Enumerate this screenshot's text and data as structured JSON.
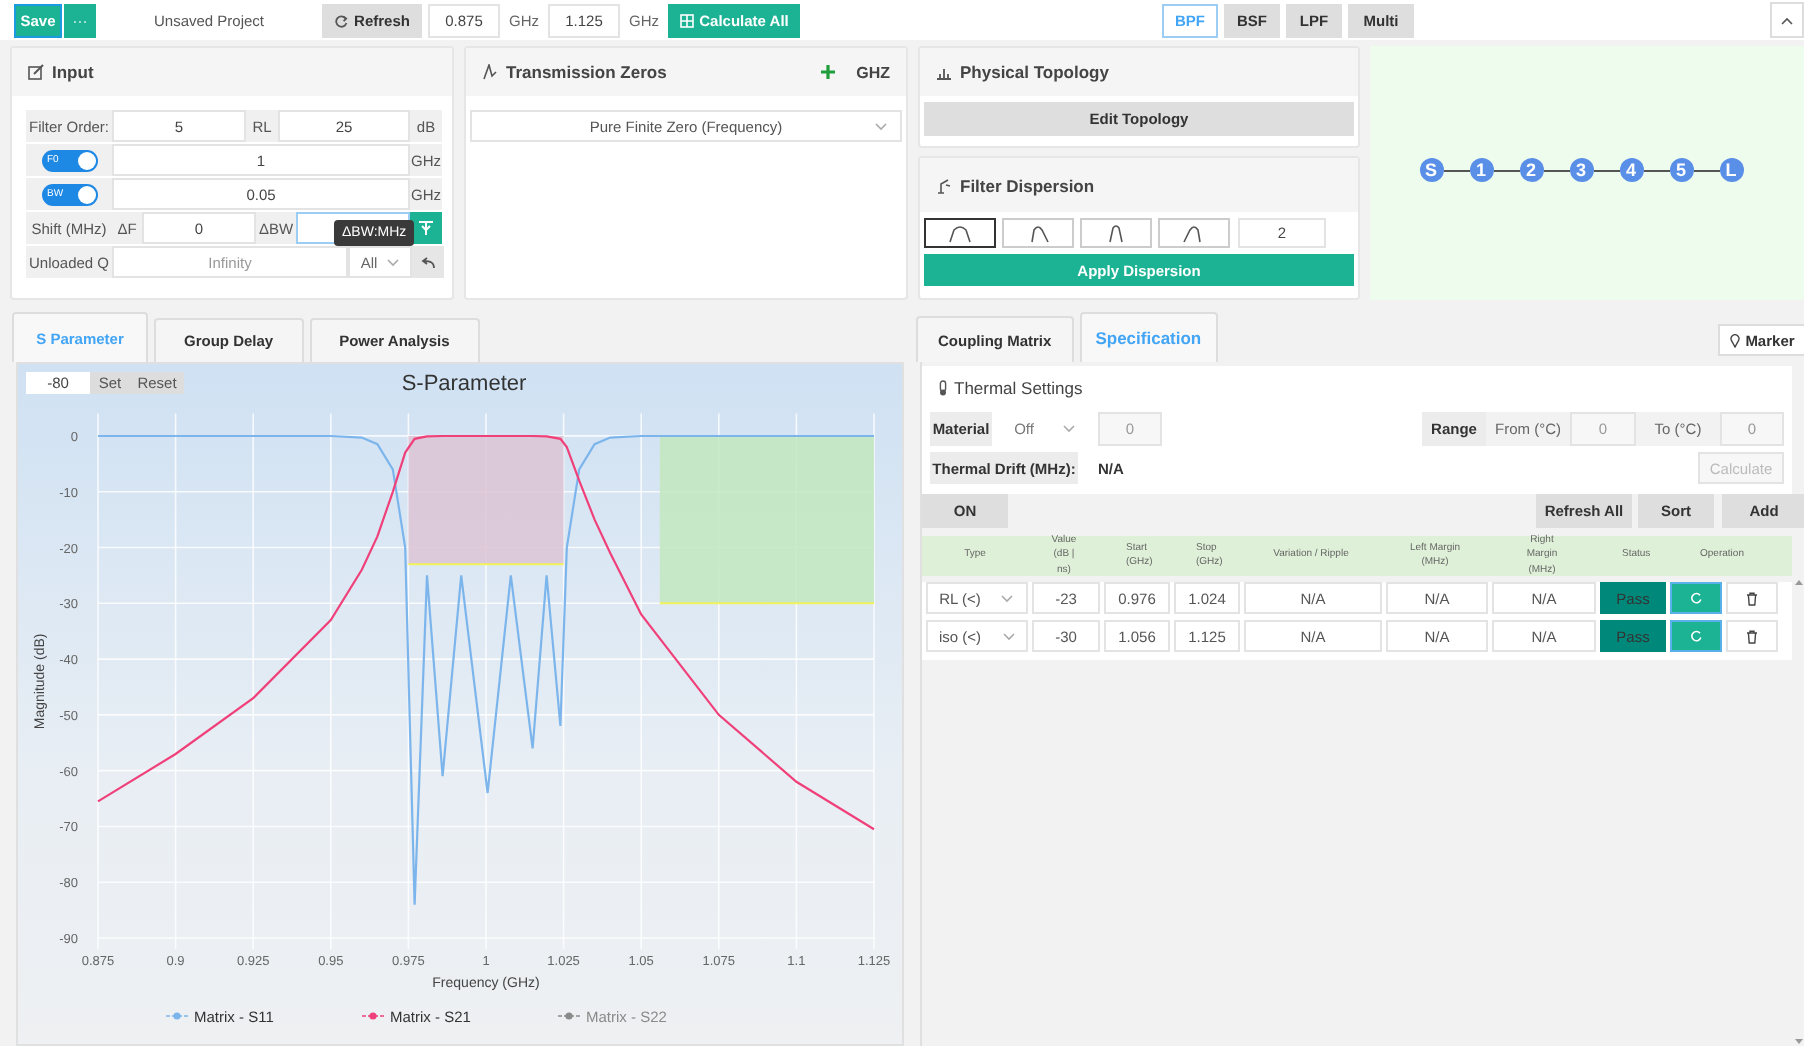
{
  "toolbar": {
    "save": "Save",
    "more": "···",
    "project_name": "Unsaved Project",
    "refresh": "Refresh",
    "freq_start": "0.875",
    "freq_start_unit": "GHz",
    "freq_stop": "1.125",
    "freq_stop_unit": "GHz",
    "calculate": "Calculate All",
    "filter_types": [
      {
        "label": "BPF",
        "selected": true
      },
      {
        "label": "BSF",
        "selected": false
      },
      {
        "label": "LPF",
        "selected": false
      },
      {
        "label": "Multi",
        "selected": false
      }
    ]
  },
  "input": {
    "title": "Input",
    "filter_order_label": "Filter Order:",
    "filter_order": "5",
    "rl_label": "RL",
    "rl": "25",
    "rl_unit": "dB",
    "f0_toggle": {
      "label": "F0",
      "on": true
    },
    "f0": "1",
    "f0_unit": "GHz",
    "bw_toggle": {
      "label": "BW",
      "on": true
    },
    "bw": "0.05",
    "bw_unit": "GHz",
    "shift_label": "Shift (MHz)",
    "delta_f_label": "ΔF",
    "delta_f": "0",
    "delta_bw_label": "ΔBW",
    "tooltip": "ΔBW:MHz",
    "q_label": "Unloaded Q",
    "q_value": "Infinity",
    "q_scope": "All"
  },
  "transmission_zeros": {
    "title": "Transmission Zeros",
    "unit": "GHZ",
    "type": "Pure Finite Zero (Frequency)"
  },
  "physical_topology": {
    "title": "Physical Topology",
    "edit": "Edit Topology"
  },
  "filter_dispersion": {
    "title": "Filter Dispersion",
    "value": "2",
    "apply": "Apply Dispersion",
    "shapes": [
      {
        "kind": "wide",
        "selected": true
      },
      {
        "kind": "right-skew",
        "selected": false
      },
      {
        "kind": "narrow",
        "selected": false
      },
      {
        "kind": "left-skew",
        "selected": false
      }
    ]
  },
  "topology": {
    "nodes": [
      "S",
      "1",
      "2",
      "3",
      "4",
      "5",
      "L"
    ]
  },
  "chart_tabs": [
    {
      "label": "S Parameter",
      "selected": true
    },
    {
      "label": "Group Delay",
      "selected": false
    },
    {
      "label": "Power Analysis",
      "selected": false
    }
  ],
  "chart": {
    "limit_value": "-80",
    "set": "Set",
    "reset": "Reset",
    "legend": [
      {
        "visible": true
      },
      {
        "visible": true
      },
      {
        "visible": false
      }
    ],
    "chart_data": {
      "type": "line",
      "grid": true,
      "title": "S-Parameter",
      "xlabel": "Frequency (GHz)",
      "ylabel": "Magnitude (dB)",
      "xlim": [
        0.875,
        1.125
      ],
      "ylim": [
        -92,
        4
      ],
      "xticks": [
        0.875,
        0.9,
        0.925,
        0.95,
        0.975,
        1,
        1.025,
        1.05,
        1.075,
        1.1,
        1.125
      ],
      "yticks": [
        0,
        -10,
        -20,
        -30,
        -40,
        -50,
        -60,
        -70,
        -80,
        -90
      ],
      "x": [
        0.875,
        0.9,
        0.925,
        0.95,
        0.96,
        0.965,
        0.97,
        0.974,
        0.977,
        0.981,
        0.986,
        0.992,
        1.0005,
        1.008,
        1.015,
        1.0195,
        1.024,
        1.026,
        1.03,
        1.035,
        1.04,
        1.05,
        1.075,
        1.1,
        1.125
      ],
      "series": [
        {
          "name": "Matrix - S11",
          "color": "#7cb5ec",
          "values": [
            0,
            0,
            0,
            0,
            -0.3,
            -1.5,
            -6,
            -20,
            -84,
            -25,
            -61,
            -25,
            -64,
            -25,
            -56,
            -25,
            -52,
            -20,
            -6,
            -1.5,
            -0.3,
            0,
            0,
            0,
            0
          ]
        },
        {
          "name": "Matrix - S21",
          "color": "#f0407a",
          "values": [
            -65.5,
            -57,
            -47,
            -33,
            -24,
            -18,
            -10,
            -3,
            -0.5,
            -0.1,
            0,
            0,
            0,
            0,
            0,
            -0.1,
            -0.5,
            -2,
            -8,
            -15,
            -21,
            -32,
            -50,
            -62,
            -70.5
          ]
        },
        {
          "name": "Matrix - S22",
          "color": "#8a8a8a",
          "values": [
            null,
            null,
            null,
            null,
            null,
            null,
            null,
            null,
            null,
            null,
            null,
            null,
            null,
            null,
            null,
            null,
            null,
            null,
            null,
            null,
            null,
            null,
            null,
            null,
            null
          ]
        }
      ],
      "bands": [
        {
          "axis": "x",
          "from": 0.975,
          "to": 1.025,
          "color": "#dcc3d3"
        },
        {
          "axis": "x",
          "from": 1.056,
          "to": 1.125,
          "color": "#c2e8bd"
        }
      ],
      "ref_lines": [
        {
          "axis": "y",
          "value": -23,
          "color": "#f2f25a"
        },
        {
          "axis": "y",
          "value": -30,
          "color": "#f2f25a"
        }
      ]
    }
  },
  "spec_tabs": [
    {
      "label": "Coupling Matrix",
      "selected": false
    },
    {
      "label": "Specification",
      "selected": true
    }
  ],
  "marker": "Marker",
  "thermal": {
    "title": "Thermal Settings",
    "material_label": "Material",
    "material": "Off",
    "material_value": "0",
    "range_label": "Range",
    "from_label": "From (°C)",
    "from": "0",
    "to_label": "To (°C)",
    "to": "0",
    "drift_label": "Thermal Drift (MHz):",
    "drift": "N/A",
    "calculate": "Calculate",
    "calculate_disabled": true
  },
  "spec_toolbar": {
    "on": "ON",
    "refresh_all": "Refresh All",
    "sort": "Sort",
    "add": "Add"
  },
  "spec_table": {
    "columns": [
      "Type",
      "Value (dB | ns)",
      "Start (GHz)",
      "Stop (GHz)",
      "Variation / Ripple",
      "Left Margin (MHz)",
      "Right Margin (MHz)",
      "Status",
      "Operation"
    ],
    "rows": [
      {
        "type": "RL (<)",
        "value": "-23",
        "start": "0.976",
        "stop": "1.024",
        "variation": "N/A",
        "left_margin": "N/A",
        "right_margin": "N/A",
        "status": "Pass"
      },
      {
        "type": "iso (<)",
        "value": "-30",
        "start": "1.056",
        "stop": "1.125",
        "variation": "N/A",
        "left_margin": "N/A",
        "right_margin": "N/A",
        "status": "Pass"
      }
    ]
  }
}
